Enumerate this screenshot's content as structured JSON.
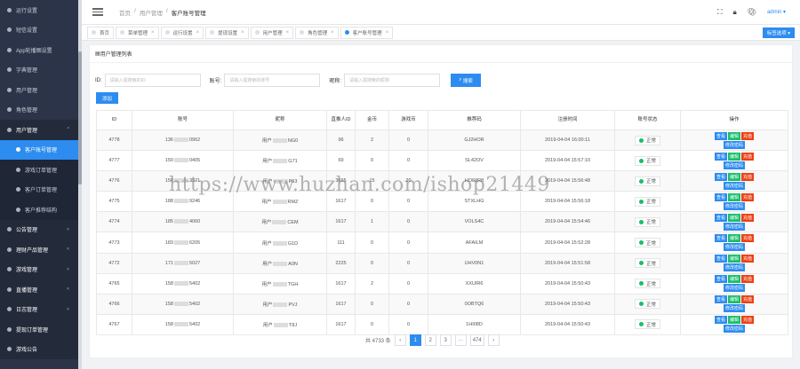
{
  "sidebar": {
    "items": [
      {
        "label": "运行设置",
        "kind": "sub"
      },
      {
        "label": "短信设置",
        "kind": "sub"
      },
      {
        "label": "App轮播图设置",
        "kind": "sub"
      },
      {
        "label": "字典管理",
        "kind": "sub"
      },
      {
        "label": "用户管理",
        "kind": "sub"
      },
      {
        "label": "角色管理",
        "kind": "sub"
      },
      {
        "label": "用户管理",
        "kind": "group",
        "arrow": "^"
      },
      {
        "label": "客户账号管理",
        "kind": "sub-active"
      },
      {
        "label": "游戏订单管理",
        "kind": "sub"
      },
      {
        "label": "客户订单管理",
        "kind": "sub"
      },
      {
        "label": "客户推荐结构",
        "kind": "sub"
      },
      {
        "label": "公告管理",
        "kind": "group",
        "arrow": "<"
      },
      {
        "label": "理财产品管理",
        "kind": "group",
        "arrow": "<"
      },
      {
        "label": "游戏管理",
        "kind": "group",
        "arrow": "<"
      },
      {
        "label": "直播管理",
        "kind": "group",
        "arrow": "<"
      },
      {
        "label": "日志管理",
        "kind": "group",
        "arrow": "<"
      },
      {
        "label": "提现订单管理",
        "kind": "group",
        "arrow": ""
      },
      {
        "label": "游戏公告",
        "kind": "group",
        "arrow": ""
      }
    ]
  },
  "header": {
    "breadcrumb": [
      "首页",
      "/",
      "用户管理",
      "/",
      "客户账号管理"
    ],
    "admin": "admin ▾",
    "icons": [
      "fullscreen-icon",
      "lock-icon",
      "theme-icon"
    ]
  },
  "tabs": [
    {
      "label": "首页",
      "active": false
    },
    {
      "label": "菜单管理",
      "active": false
    },
    {
      "label": "运行设置",
      "active": false
    },
    {
      "label": "提现设置",
      "active": false
    },
    {
      "label": "用户管理",
      "active": false
    },
    {
      "label": "角色管理",
      "active": false
    },
    {
      "label": "客户账号管理",
      "active": true
    }
  ],
  "tab_options": "标签选项 ▾",
  "panel": {
    "title": "用户管理列表",
    "filters": {
      "id_label": "ID:",
      "id_placeholder": "请输入需搜索的ID",
      "account_label": "账号:",
      "account_placeholder": "请输入需搜索的账号",
      "nick_label": "昵称:",
      "nick_placeholder": "请输入需搜索的昵称",
      "search": "搜索"
    },
    "add": "添加"
  },
  "table": {
    "headers": [
      "ID",
      "账号",
      "昵称",
      "直推人ID",
      "金币",
      "游戏币",
      "推荐码",
      "注册时间",
      "账号状态",
      "操作"
    ],
    "rows": [
      {
        "id": "4778",
        "account": [
          "136",
          "0962"
        ],
        "nick": [
          "用户",
          "NG0"
        ],
        "ref": "96",
        "gold": "2",
        "coin": "0",
        "code": "GJ2HOR",
        "time": "2019-04-04 16:00:11",
        "status": "正常"
      },
      {
        "id": "4777",
        "account": [
          "150",
          "0405"
        ],
        "nick": [
          "用户",
          "G71"
        ],
        "ref": "69",
        "gold": "0",
        "coin": "0",
        "code": "SL42OV",
        "time": "2019-04-04 15:57:10",
        "status": "正常"
      },
      {
        "id": "4776",
        "account": [
          "150",
          "3371"
        ],
        "nick": [
          "用户",
          "P63"
        ],
        "ref": "3665",
        "gold": "15",
        "coin": "20",
        "code": "HO69R8",
        "time": "2019-04-04 15:56:48",
        "status": "正常"
      },
      {
        "id": "4775",
        "account": [
          "188",
          "9246"
        ],
        "nick": [
          "用户",
          "RMZ"
        ],
        "ref": "1617",
        "gold": "0",
        "coin": "0",
        "code": "STXLHG",
        "time": "2019-04-04 15:56:18",
        "status": "正常"
      },
      {
        "id": "4774",
        "account": [
          "185",
          "4060"
        ],
        "nick": [
          "用户",
          "CEM"
        ],
        "ref": "1617",
        "gold": "1",
        "coin": "0",
        "code": "VOLS4C",
        "time": "2019-04-04 15:54:46",
        "status": "正常"
      },
      {
        "id": "4773",
        "account": [
          "183",
          "6205"
        ],
        "nick": [
          "用户",
          "G1D"
        ],
        "ref": "111",
        "gold": "0",
        "coin": "0",
        "code": "AFAILM",
        "time": "2019-04-04 15:52:28",
        "status": "正常"
      },
      {
        "id": "4772",
        "account": [
          "171",
          "5027"
        ],
        "nick": [
          "用户",
          "A0N"
        ],
        "ref": "2225",
        "gold": "0",
        "coin": "0",
        "code": "UHV0N1",
        "time": "2019-04-04 15:51:58",
        "status": "正常"
      },
      {
        "id": "4765",
        "account": [
          "158",
          "5402"
        ],
        "nick": [
          "用户",
          "TGH"
        ],
        "ref": "1617",
        "gold": "2",
        "coin": "0",
        "code": "XXUIR6",
        "time": "2019-04-04 15:50:43",
        "status": "正常"
      },
      {
        "id": "4766",
        "account": [
          "158",
          "5402"
        ],
        "nick": [
          "用户",
          "PVJ"
        ],
        "ref": "1617",
        "gold": "0",
        "coin": "0",
        "code": "0OBTQ6",
        "time": "2019-04-04 15:50:43",
        "status": "正常"
      },
      {
        "id": "4767",
        "account": [
          "158",
          "5402"
        ],
        "nick": [
          "用户",
          "T8J"
        ],
        "ref": "1617",
        "gold": "0",
        "coin": "0",
        "code": "1HI08D",
        "time": "2019-04-04 15:50:43",
        "status": "正常"
      }
    ],
    "ops": {
      "view": "查看",
      "edit": "编辑",
      "charge": "充值",
      "pwd": "修改密码"
    }
  },
  "pager": {
    "total": "共 4733 条",
    "prev": "‹",
    "pages": [
      "1",
      "2",
      "3",
      "···",
      "474"
    ],
    "active_page": "1",
    "next": "›"
  },
  "watermark": "https://www.huzhan.com/ishop21449"
}
